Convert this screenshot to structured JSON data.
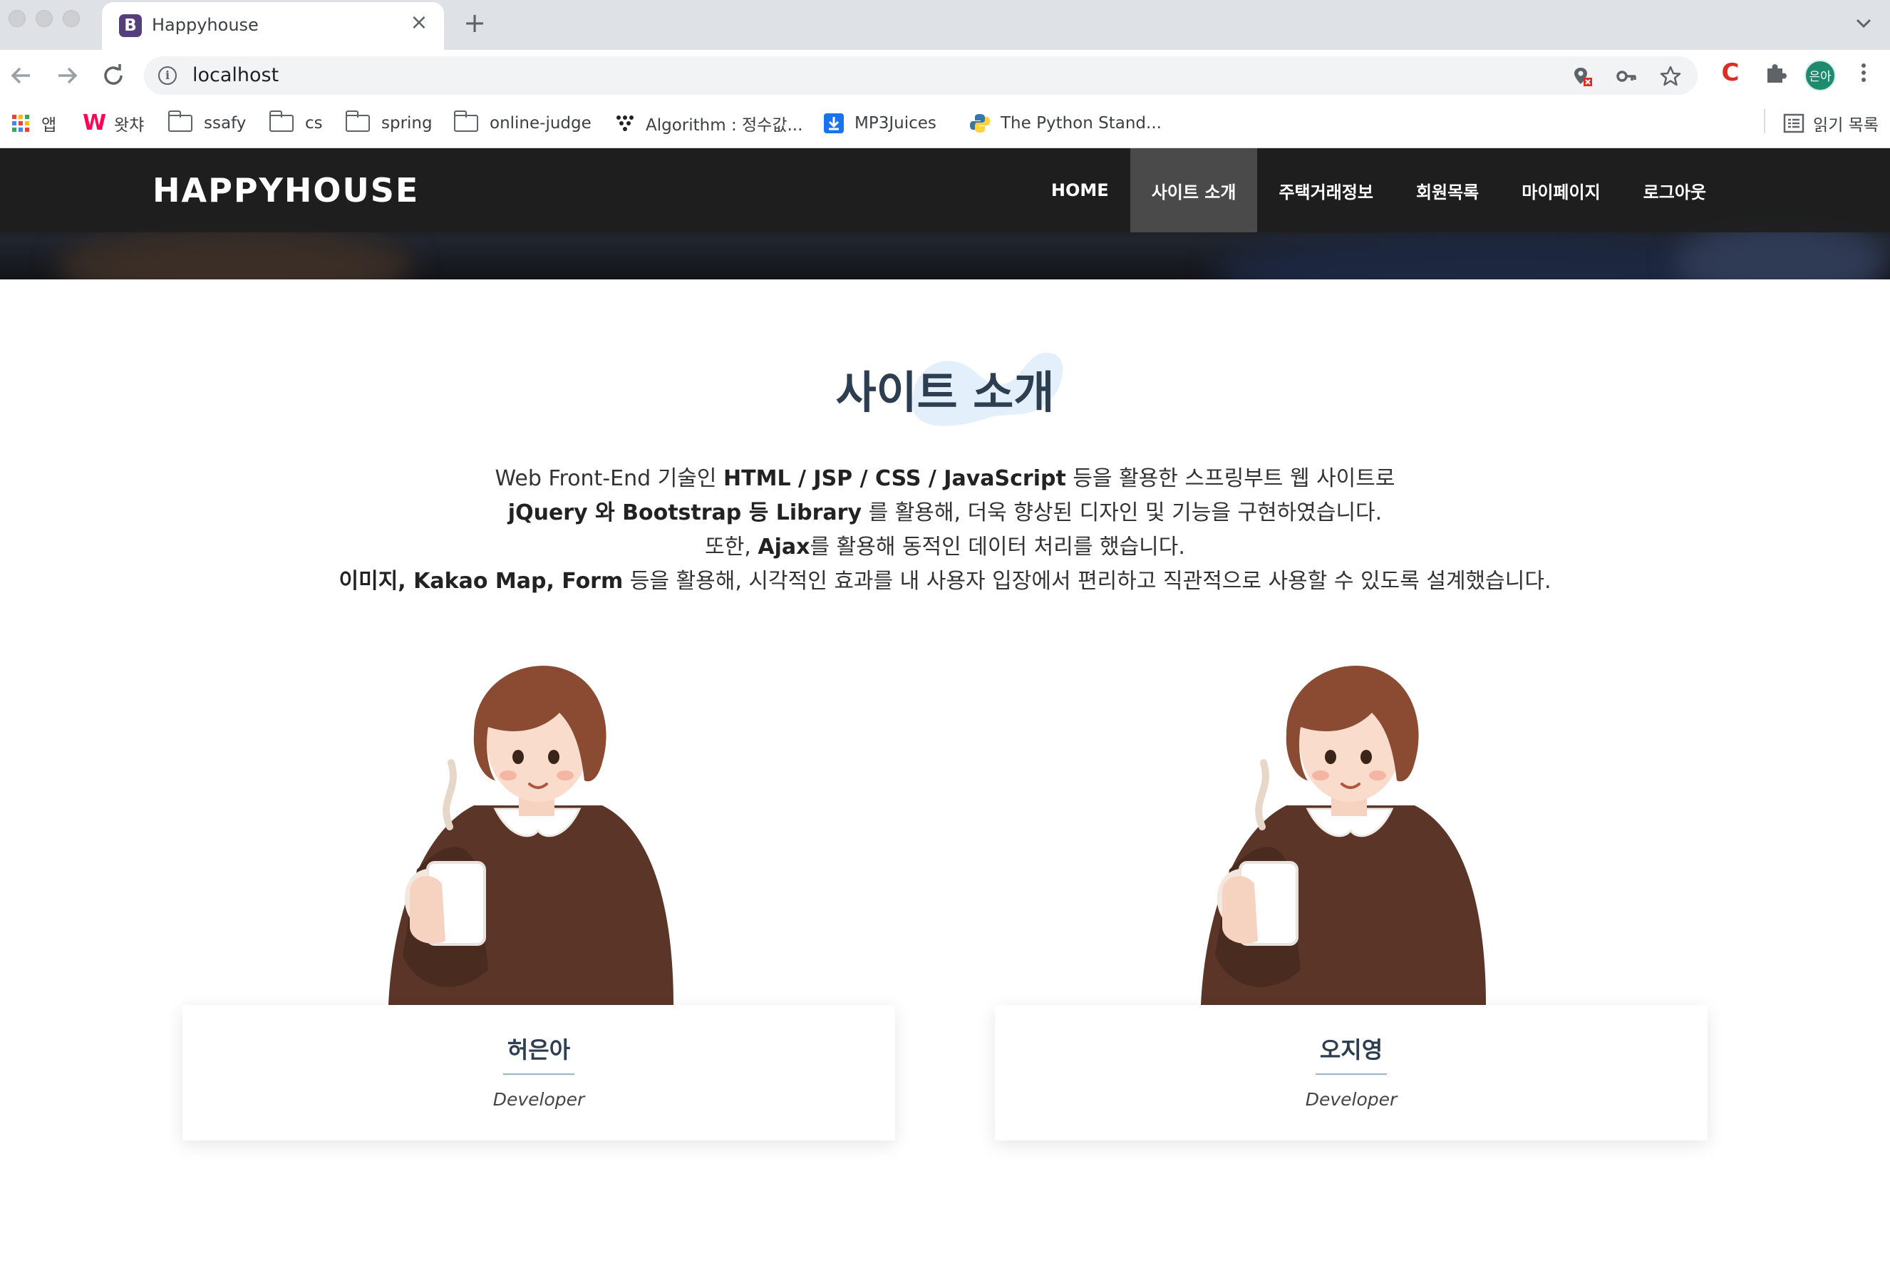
{
  "browser": {
    "tab_title": "Happyhouse",
    "tab_favicon_letter": "B",
    "url": "localhost",
    "profile_initials": "은아",
    "extension_label": "C",
    "bookmarks": [
      {
        "label": "앱",
        "icon": "apps-grid-icon"
      },
      {
        "label": "왓챠",
        "icon": "watcha-icon"
      },
      {
        "label": "ssafy",
        "icon": "folder-icon"
      },
      {
        "label": "cs",
        "icon": "folder-icon"
      },
      {
        "label": "spring",
        "icon": "folder-icon"
      },
      {
        "label": "online-judge",
        "icon": "folder-icon"
      },
      {
        "label": "Algorithm : 정수값...",
        "icon": "dots-icon"
      },
      {
        "label": "MP3Juices",
        "icon": "download-icon"
      },
      {
        "label": "The Python Stand...",
        "icon": "python-icon"
      }
    ],
    "reading_list": "읽기 목록"
  },
  "site": {
    "brand": "HAPPYHOUSE",
    "menu": [
      "HOME",
      "사이트 소개",
      "주택거래정보",
      "회원목록",
      "마이페이지",
      "로그아웃"
    ],
    "active_menu": "사이트 소개"
  },
  "about": {
    "title": "사이트 소개",
    "intro": {
      "line1": {
        "a": "Web Front-End 기술인 ",
        "b": "HTML / JSP / CSS / JavaScript",
        "c": " 등을 활용한 스프링부트 웹 사이트로"
      },
      "line2": {
        "b": "jQuery 와 Bootstrap 등 Library",
        "c": " 를 활용해, 더욱 향상된 디자인 및 기능을 구현하였습니다."
      },
      "line3": {
        "a": "또한, ",
        "b": "Ajax",
        "c": "를 활용해 동적인 데이터 처리를 했습니다."
      },
      "line4": {
        "b": "이미지, Kakao Map, Form",
        "c": " 등을 활용해, 시각적인 효과를 내 사용자 입장에서 편리하고 직관적으로 사용할 수 있도록 설계했습니다."
      }
    },
    "team": [
      {
        "name": "허은아",
        "role": "Developer"
      },
      {
        "name": "오지영",
        "role": "Developer"
      }
    ]
  },
  "colors": {
    "navbar_bg": "#1e1e1e",
    "active_menu_bg": "#4a4a4a",
    "title_color": "#2c3e50",
    "tab_favicon": "#563d7c"
  }
}
